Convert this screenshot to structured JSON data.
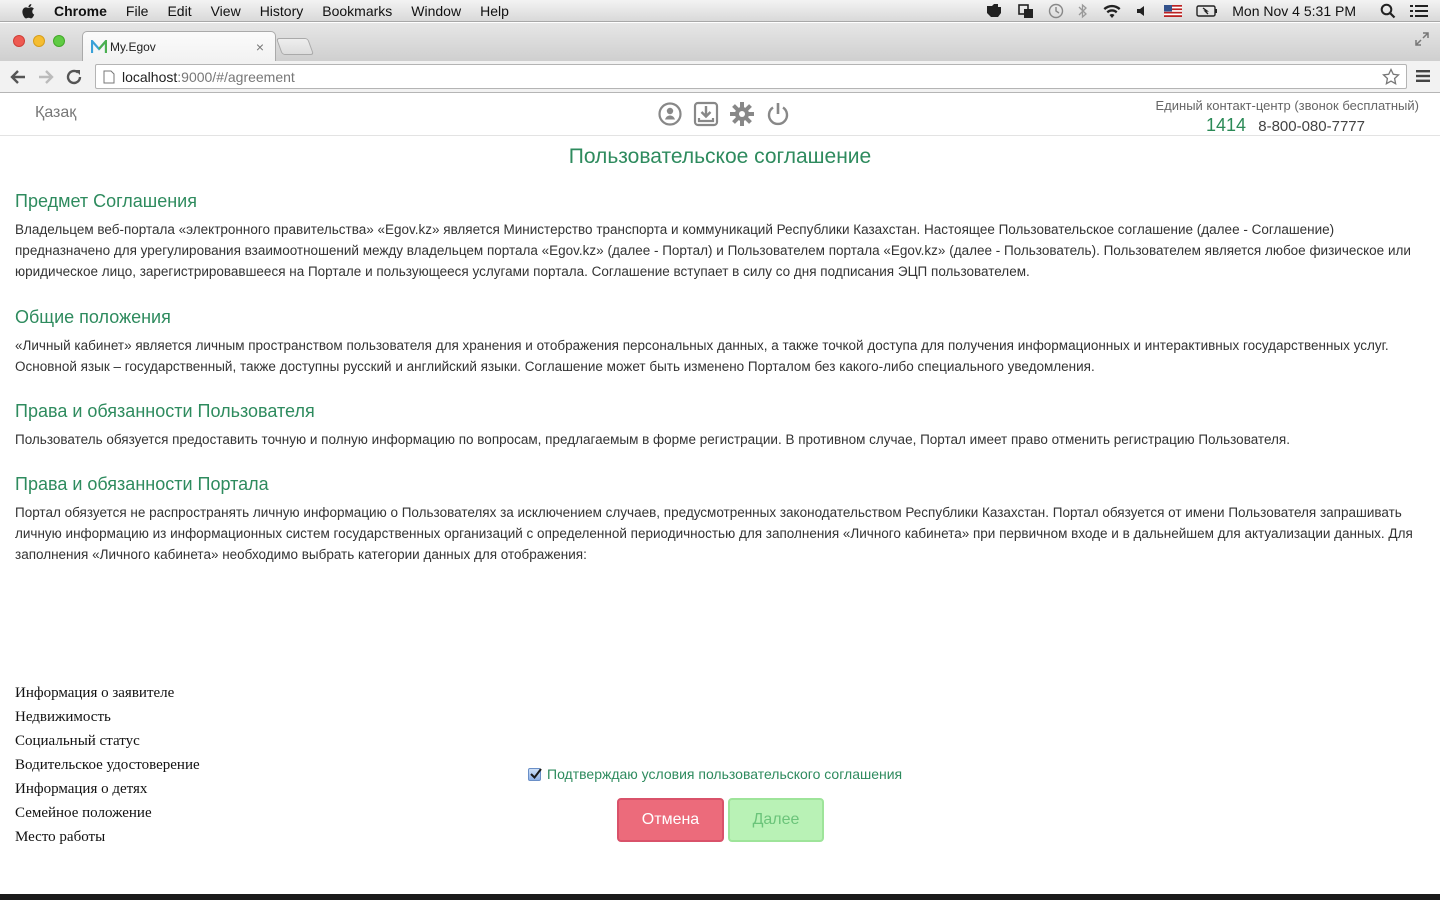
{
  "menubar": {
    "app_name": "Chrome",
    "items": [
      "File",
      "Edit",
      "View",
      "History",
      "Bookmarks",
      "Window",
      "Help"
    ],
    "clock": "Mon Nov 4  5:31 PM"
  },
  "browser": {
    "tab_title": "My.Egov",
    "tab_close": "×",
    "url_host": "localhost",
    "url_path": ":9000/#/agreement"
  },
  "header": {
    "language_link": "Қазақ",
    "contact_title": "Единый контакт-центр (звонок бесплатный)",
    "short_number": "1414",
    "long_number": "8-800-080-7777"
  },
  "page": {
    "title": "Пользовательское соглашение"
  },
  "sections": [
    {
      "heading": "Предмет Соглашения",
      "text": "Владельцем веб-портала «электронного правительства» «Egov.kz» является Министерство транспорта и коммуникаций Республики Казахстан. Настоящее Пользовательское соглашение (далее - Соглашение) предназначено для урегулирования взаимоотношений между владельцем портала «Egov.kz» (далее - Портал) и Пользователем портала «Egov.kz» (далее - Пользователь). Пользователем является любое физическое или юридическое лицо, зарегистрировавшееся на Портале и пользующееся услугами портала. Соглашение вступает в силу со дня подписания ЭЦП пользователем."
    },
    {
      "heading": "Общие положения",
      "text": "«Личный кабинет» является личным пространством пользователя для хранения и отображения персональных данных, а также точкой доступа для получения информационных и интерактивных государственных услуг. Основной язык – государственный, также доступны русский и английский языки. Соглашение может быть изменено Порталом без какого-либо специального уведомления."
    },
    {
      "heading": "Права и обязанности Пользователя",
      "text": "Пользователь обязуется предоставить точную и полную информацию по вопросам, предлагаемым в форме регистрации. В противном случае, Портал имеет право отменить регистрацию Пользователя."
    },
    {
      "heading": "Права и обязанности Портала",
      "text": "Портал обязуется не распространять личную информацию о Пользователях за исключением случаев, предусмотренных законодательством Республики Казахстан. Портал обязуется от имени Пользователя запрашивать личную информацию из информационных систем государственных организаций с определенной периодичностью для заполнения «Личного кабинета» при первичном входе и в дальнейшем для актуализации данных. Для заполнения «Личного кабинета» необходимо выбрать категории данных для отображения:"
    }
  ],
  "categories": [
    "Информация о заявителе",
    "Недвижимость",
    "Социальный статус",
    "Водительское удостоверение",
    "Информация о детях",
    "Семейное положение",
    "Место работы"
  ],
  "agreement": {
    "label": "Подтверждаю условия пользовательского соглашения",
    "checked": true
  },
  "buttons": {
    "cancel": "Отмена",
    "next": "Далее"
  },
  "colors": {
    "accent_green": "#2e8b5e",
    "cancel_red": "#ec6b7b",
    "next_disabled_green": "#b9f2b6"
  }
}
